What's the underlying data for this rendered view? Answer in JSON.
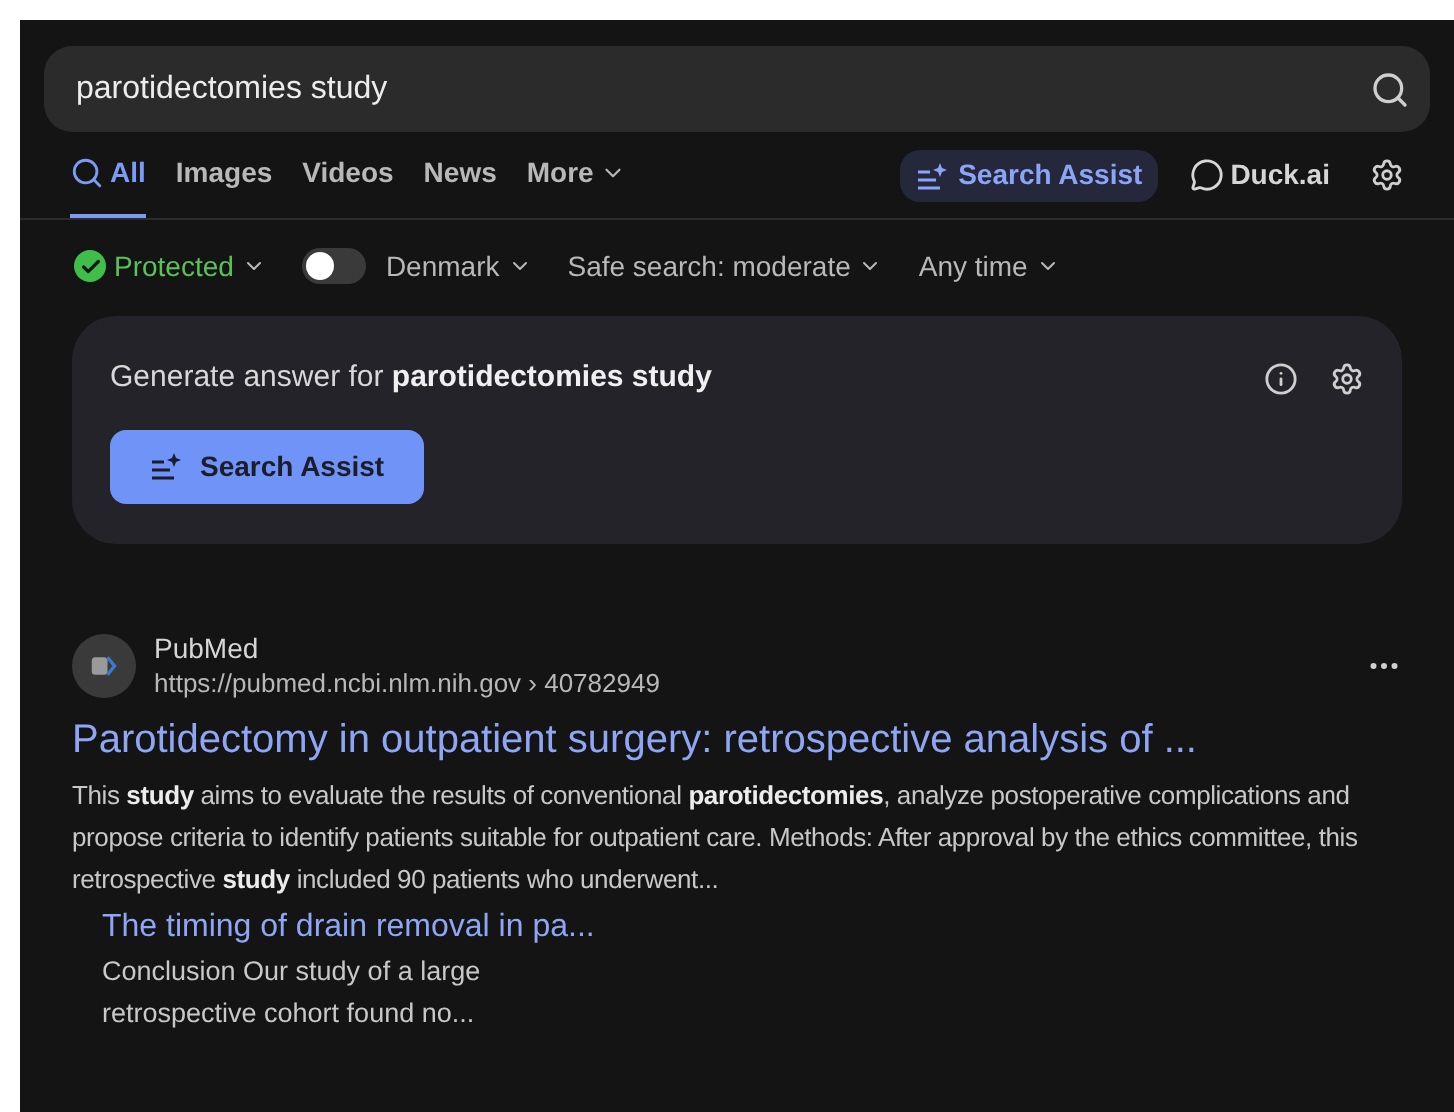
{
  "search": {
    "value": "parotidectomies study"
  },
  "tabs": [
    {
      "label": "All",
      "selected": true,
      "kind": "search"
    },
    {
      "label": "Images",
      "selected": false,
      "kind": "plain"
    },
    {
      "label": "Videos",
      "selected": false,
      "kind": "plain"
    },
    {
      "label": "News",
      "selected": false,
      "kind": "plain"
    },
    {
      "label": "More",
      "selected": false,
      "kind": "menu"
    }
  ],
  "actions": [
    {
      "label": "Search Assist",
      "kind": "assist"
    },
    {
      "label": "Duck.ai",
      "kind": "chat"
    }
  ],
  "filters": [
    {
      "kind": "protection",
      "label": "Protected"
    },
    {
      "kind": "region",
      "label": "Denmark",
      "on": false
    },
    {
      "kind": "menu",
      "label": "Safe search: moderate"
    },
    {
      "kind": "menu",
      "label": "Any time"
    }
  ],
  "assist_card": {
    "prompt": "Generate answer for **parotidectomies study**",
    "button": "Search Assist"
  },
  "results": [
    {
      "source": "PubMed",
      "url": "https://pubmed.ncbi.nlm.nih.gov › 40782949",
      "title": "Parotidectomy in outpatient surgery: retrospective analysis of ...",
      "snippet": "This **study** aims to evaluate the results of conventional **parotidectomies**, analyze postoperative complications and propose criteria to identify patients suitable for outpatient care. Methods: After approval by the ethics committee, this retrospective **study** included 90 patients who underwent...",
      "sublinks": [
        {
          "title": "The timing of drain removal in pa...",
          "snippet": "Conclusion Our study of a large retrospective cohort found no..."
        }
      ]
    }
  ]
}
